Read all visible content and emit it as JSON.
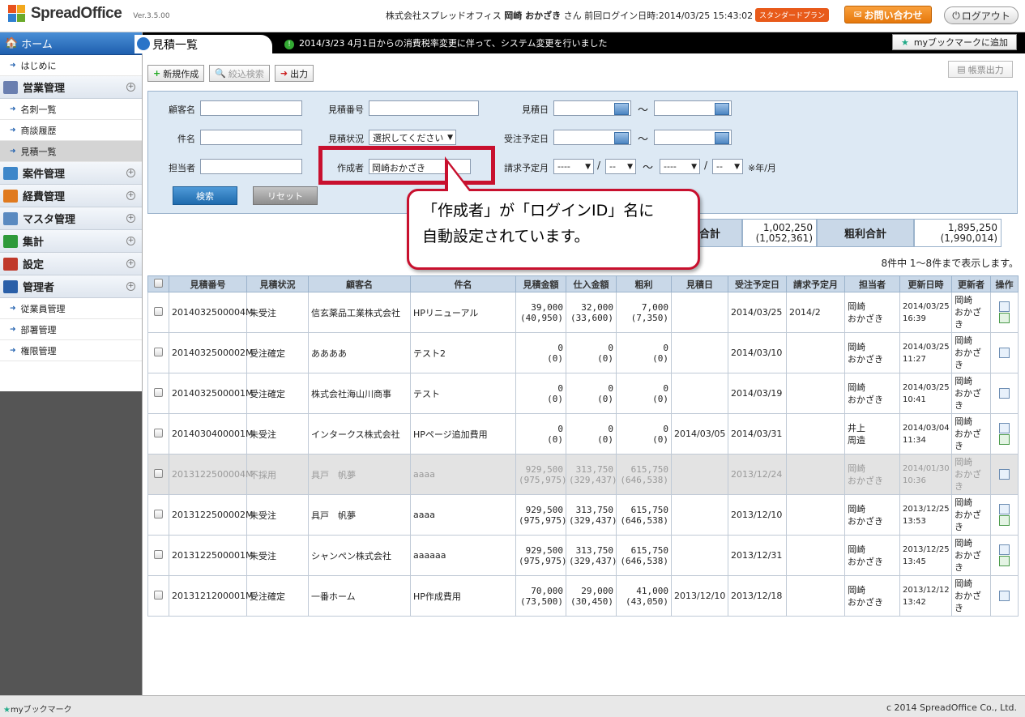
{
  "header": {
    "logo": "SpreadOffice",
    "version": "Ver.3.5.00",
    "company": "株式会社スプレッドオフィス",
    "user": "岡崎 おかざき",
    "honorific": "さん",
    "last_login_label": "前回ログイン日時:",
    "last_login": "2014/03/25 15:43:02",
    "plan_badge": "スタンダードプラン",
    "contact_button": "お問い合わせ",
    "logout_button": "ログアウト"
  },
  "sidebar": {
    "home": "ホーム",
    "items": [
      {
        "type": "sub",
        "label": "はじめに"
      },
      {
        "type": "cat",
        "label": "営業管理",
        "color": "#6a7fb0"
      },
      {
        "type": "sub",
        "label": "名刺一覧"
      },
      {
        "type": "sub",
        "label": "商談履歴"
      },
      {
        "type": "sub",
        "label": "見積一覧",
        "active": true
      },
      {
        "type": "cat",
        "label": "案件管理",
        "color": "#3d86c9"
      },
      {
        "type": "cat",
        "label": "経費管理",
        "color": "#e07a1f"
      },
      {
        "type": "cat",
        "label": "マスタ管理",
        "color": "#5a8ac0"
      },
      {
        "type": "cat",
        "label": "集計",
        "color": "#2e9a3a"
      },
      {
        "type": "cat",
        "label": "設定",
        "color": "#c0392b"
      },
      {
        "type": "cat",
        "label": "管理者",
        "color": "#2a5fa8"
      },
      {
        "type": "sub",
        "label": "従業員管理"
      },
      {
        "type": "sub",
        "label": "部署管理"
      },
      {
        "type": "sub",
        "label": "権限管理"
      }
    ]
  },
  "page": {
    "title": "見積一覧",
    "notice": "2014/3/23  4月1日からの消費税率変更に伴って、システム変更を行いました",
    "bookmark_add": "myブックマークに追加",
    "new_button": "新規作成",
    "filter_button": "絞込検索",
    "export_button": "出力",
    "report_button": "帳票出力"
  },
  "search": {
    "customer_label": "顧客名",
    "quote_no_label": "見積番号",
    "quote_date_label": "見積日",
    "subject_label": "件名",
    "status_label": "見積状況",
    "status_value": "選択してください",
    "order_date_label": "受注予定日",
    "owner_label": "担当者",
    "creator_label": "作成者",
    "creator_value": "岡崎おかざき",
    "bill_month_label": "請求予定月",
    "year_placeholder": "----",
    "month_placeholder": "--",
    "tilde": "〜",
    "slash": "/",
    "ym_note": "※年/月",
    "search_button": "検索",
    "reset_button": "リセット"
  },
  "callout": {
    "line1": "「作成者」が「ログインID」名に",
    "line2": "自動設定されています。"
  },
  "totals": {
    "label1_partial": "合計",
    "value1": "1,002,250",
    "value1_sub": "(1,052,361)",
    "label2": "粗利合計",
    "value2": "1,895,250",
    "value2_sub": "(1,990,014)"
  },
  "count_text": "8件中 1〜8件まで表示します。",
  "table": {
    "headers": [
      "",
      "見積番号",
      "見積状況",
      "顧客名",
      "件名",
      "見積金額",
      "仕入金額",
      "粗利",
      "見積日",
      "受注予定日",
      "請求予定月",
      "担当者",
      "更新日時",
      "更新者",
      "操作"
    ],
    "rows": [
      {
        "no": "2014032500004M",
        "status": "未受注",
        "customer": "信玄薬品工業株式会社",
        "subject": "HPリニューアル",
        "amount": "39,000",
        "amount_sub": "(40,950)",
        "cost": "32,000",
        "cost_sub": "(33,600)",
        "profit": "7,000",
        "profit_sub": "(7,350)",
        "qdate": "",
        "odate": "2014/03/25",
        "bill": "2014/2",
        "owner1": "岡崎",
        "owner2": "おかざき",
        "upd1": "2014/03/25",
        "upd2": "16:39",
        "upd_by1": "岡崎",
        "upd_by2": "おかざき",
        "gray": false,
        "ops": 2
      },
      {
        "no": "2014032500002M",
        "status": "受注確定",
        "customer": "ああああ",
        "subject": "テスト2",
        "amount": "0",
        "amount_sub": "(0)",
        "cost": "0",
        "cost_sub": "(0)",
        "profit": "0",
        "profit_sub": "(0)",
        "qdate": "",
        "odate": "2014/03/10",
        "bill": "",
        "owner1": "岡崎",
        "owner2": "おかざき",
        "upd1": "2014/03/25",
        "upd2": "11:27",
        "upd_by1": "岡崎",
        "upd_by2": "おかざき",
        "gray": false,
        "ops": 1
      },
      {
        "no": "2014032500001M",
        "status": "受注確定",
        "customer": "株式会社海山川商事",
        "subject": "テスト",
        "amount": "0",
        "amount_sub": "(0)",
        "cost": "0",
        "cost_sub": "(0)",
        "profit": "0",
        "profit_sub": "(0)",
        "qdate": "",
        "odate": "2014/03/19",
        "bill": "",
        "owner1": "岡崎",
        "owner2": "おかざき",
        "upd1": "2014/03/25",
        "upd2": "10:41",
        "upd_by1": "岡崎",
        "upd_by2": "おかざき",
        "gray": false,
        "ops": 1
      },
      {
        "no": "2014030400001M",
        "status": "未受注",
        "customer": "インタークス株式会社",
        "subject": "HPページ追加費用",
        "amount": "0",
        "amount_sub": "(0)",
        "cost": "0",
        "cost_sub": "(0)",
        "profit": "0",
        "profit_sub": "(0)",
        "qdate": "2014/03/05",
        "odate": "2014/03/31",
        "bill": "",
        "owner1": "井上",
        "owner2": "周造",
        "upd1": "2014/03/04",
        "upd2": "11:34",
        "upd_by1": "岡崎",
        "upd_by2": "おかざき",
        "gray": false,
        "ops": 2
      },
      {
        "no": "2013122500004M",
        "status": "不採用",
        "customer": "具戸　帆夢",
        "subject": "aaaa",
        "amount": "929,500",
        "amount_sub": "(975,975)",
        "cost": "313,750",
        "cost_sub": "(329,437)",
        "profit": "615,750",
        "profit_sub": "(646,538)",
        "qdate": "",
        "odate": "2013/12/24",
        "bill": "",
        "owner1": "岡崎",
        "owner2": "おかざき",
        "upd1": "2014/01/30",
        "upd2": "10:36",
        "upd_by1": "岡崎",
        "upd_by2": "おかざき",
        "gray": true,
        "ops": 1
      },
      {
        "no": "2013122500002M",
        "status": "未受注",
        "customer": "具戸　帆夢",
        "subject": "aaaa",
        "amount": "929,500",
        "amount_sub": "(975,975)",
        "cost": "313,750",
        "cost_sub": "(329,437)",
        "profit": "615,750",
        "profit_sub": "(646,538)",
        "qdate": "",
        "odate": "2013/12/10",
        "bill": "",
        "owner1": "岡崎",
        "owner2": "おかざき",
        "upd1": "2013/12/25",
        "upd2": "13:53",
        "upd_by1": "岡崎",
        "upd_by2": "おかざき",
        "gray": false,
        "ops": 2
      },
      {
        "no": "2013122500001M",
        "status": "未受注",
        "customer": "シャンペン株式会社",
        "subject": "aaaaaa",
        "amount": "929,500",
        "amount_sub": "(975,975)",
        "cost": "313,750",
        "cost_sub": "(329,437)",
        "profit": "615,750",
        "profit_sub": "(646,538)",
        "qdate": "",
        "odate": "2013/12/31",
        "bill": "",
        "owner1": "岡崎",
        "owner2": "おかざき",
        "upd1": "2013/12/25",
        "upd2": "13:45",
        "upd_by1": "岡崎",
        "upd_by2": "おかざき",
        "gray": false,
        "ops": 2
      },
      {
        "no": "2013121200001M",
        "status": "受注確定",
        "customer": "一番ホーム",
        "subject": "HP作成費用",
        "amount": "70,000",
        "amount_sub": "(73,500)",
        "cost": "29,000",
        "cost_sub": "(30,450)",
        "profit": "41,000",
        "profit_sub": "(43,050)",
        "qdate": "2013/12/10",
        "odate": "2013/12/18",
        "bill": "",
        "owner1": "岡崎",
        "owner2": "おかざき",
        "upd1": "2013/12/12",
        "upd2": "13:42",
        "upd_by1": "岡崎",
        "upd_by2": "おかざき",
        "gray": false,
        "ops": 1
      }
    ]
  },
  "footer": {
    "bookmark": "myブックマーク",
    "copyright": "c 2014 SpreadOffice Co., Ltd."
  }
}
